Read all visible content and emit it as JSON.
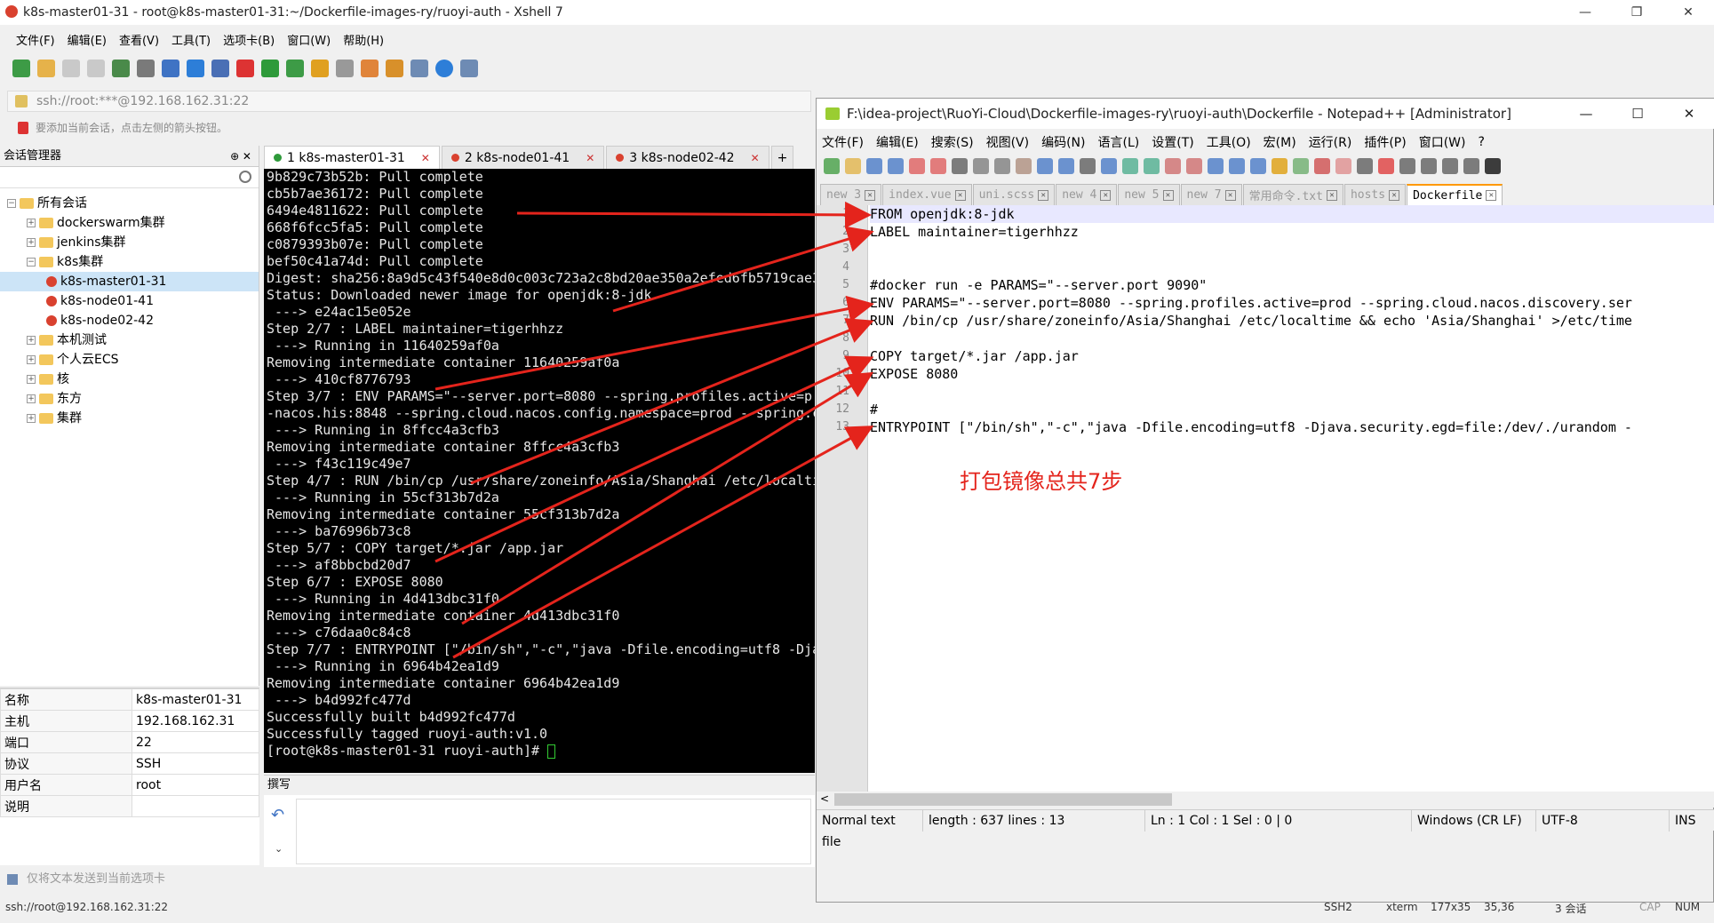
{
  "xshell": {
    "title": "k8s-master01-31 - root@k8s-master01-31:~/Dockerfile-images-ry/ruoyi-auth - Xshell 7",
    "menu": [
      "文件(F)",
      "编辑(E)",
      "查看(V)",
      "工具(T)",
      "选项卡(B)",
      "窗口(W)",
      "帮助(H)"
    ],
    "address": "ssh://root:***@192.168.162.31:22",
    "hint": "要添加当前会话，点击左侧的箭头按钮。",
    "session_manager": {
      "title": "会话管理器",
      "pins": "⊕ ✕",
      "tree": [
        {
          "label": "所有会话",
          "level": 0,
          "kind": "folder"
        },
        {
          "label": "dockerswarm集群",
          "level": 1,
          "kind": "folder"
        },
        {
          "label": "jenkins集群",
          "level": 1,
          "kind": "folder"
        },
        {
          "label": "k8s集群",
          "level": 1,
          "kind": "folder"
        },
        {
          "label": "k8s-master01-31",
          "level": 2,
          "kind": "session"
        },
        {
          "label": "k8s-node01-41",
          "level": 2,
          "kind": "session"
        },
        {
          "label": "k8s-node02-42",
          "level": 2,
          "kind": "session"
        },
        {
          "label": "本机测试",
          "level": 1,
          "kind": "folder"
        },
        {
          "label": "个人云ECS",
          "level": 1,
          "kind": "folder"
        },
        {
          "label": "核",
          "level": 1,
          "kind": "folder"
        },
        {
          "label": "东方",
          "level": 1,
          "kind": "folder"
        },
        {
          "label": "集群",
          "level": 1,
          "kind": "folder"
        }
      ]
    },
    "properties": [
      {
        "key": "名称",
        "value": "k8s-master01-31"
      },
      {
        "key": "主机",
        "value": "192.168.162.31"
      },
      {
        "key": "端口",
        "value": "22"
      },
      {
        "key": "协议",
        "value": "SSH"
      },
      {
        "key": "用户名",
        "value": "root"
      },
      {
        "key": "说明",
        "value": ""
      }
    ],
    "tabs": [
      {
        "label": "1 k8s-master01-31",
        "color": "#2e9a3a",
        "close": "✕"
      },
      {
        "label": "2 k8s-node01-41",
        "color": "#d9412f",
        "close": "✕"
      },
      {
        "label": "3 k8s-node02-42",
        "color": "#d9412f",
        "close": "✕"
      }
    ],
    "add_tab": "+",
    "terminal_lines": [
      "9b829c73b52b: Pull complete",
      "cb5b7ae36172: Pull complete",
      "6494e4811622: Pull complete",
      "668f6fcc5fa5: Pull complete",
      "c0879393b07e: Pull complete",
      "bef50c41a74d: Pull complete",
      "Digest: sha256:8a9d5c43f540e8d0c003c723a2c8bd20ae350a2efed6fb5719cae3",
      "Status: Downloaded newer image for openjdk:8-jdk",
      " ---> e24ac15e052e",
      "Step 2/7 : LABEL maintainer=tigerhhzz",
      " ---> Running in 11640259af0a",
      "Removing intermediate container 11640259af0a",
      " ---> 410cf8776793",
      "Step 3/7 : ENV PARAMS=\"--server.port=8080 --spring.profiles.active=p",
      "-nacos.his:8848 --spring.cloud.nacos.config.namespace=prod --spring.c",
      " ---> Running in 8ffcc4a3cfb3",
      "Removing intermediate container 8ffcc4a3cfb3",
      " ---> f43c119c49e7",
      "Step 4/7 : RUN /bin/cp /usr/share/zoneinfo/Asia/Shanghai /etc/localti",
      " ---> Running in 55cf313b7d2a",
      "Removing intermediate container 55cf313b7d2a",
      " ---> ba76996b73c8",
      "Step 5/7 : COPY target/*.jar /app.jar",
      " ---> af8bbcbd20d7",
      "Step 6/7 : EXPOSE 8080",
      " ---> Running in 4d413dbc31f0",
      "Removing intermediate container 4d413dbc31f0",
      " ---> c76daa0c84c8",
      "Step 7/7 : ENTRYPOINT [\"/bin/sh\",\"-c\",\"java -Dfile.encoding=utf8 -Dja",
      " ---> Running in 6964b42ea1d9",
      "Removing intermediate container 6964b42ea1d9",
      " ---> b4d992fc477d",
      "Successfully built b4d992fc477d",
      "Successfully tagged ruoyi-auth:v1.0",
      "[root@k8s-master01-31 ruoyi-auth]# "
    ],
    "compose_title": "撰写",
    "send_hint": "仅将文本发送到当前选项卡",
    "status_left": "ssh://root@192.168.162.31:22",
    "status_right": [
      "SSH2",
      "xterm",
      "177x35",
      "35,36",
      "3 会话",
      "CAP",
      "NUM"
    ]
  },
  "notepad": {
    "title": "F:\\idea-project\\RuoYi-Cloud\\Dockerfile-images-ry\\ruoyi-auth\\Dockerfile - Notepad++ [Administrator]",
    "menu": [
      "文件(F)",
      "编辑(E)",
      "搜索(S)",
      "视图(V)",
      "编码(N)",
      "语言(L)",
      "设置(T)",
      "工具(O)",
      "宏(M)",
      "运行(R)",
      "插件(P)",
      "窗口(W)",
      "?"
    ],
    "tabs": [
      "new 3",
      "index.vue",
      "uni.scss",
      "new 4",
      "new 5",
      "new 7",
      "常用命令.txt",
      "hosts",
      "Dockerfile"
    ],
    "active_tab": "Dockerfile",
    "code_lines": [
      "FROM openjdk:8-jdk",
      "LABEL maintainer=tigerhhzz",
      "",
      "",
      "#docker run -e PARAMS=\"--server.port 9090\"",
      "ENV PARAMS=\"--server.port=8080 --spring.profiles.active=prod --spring.cloud.nacos.discovery.ser",
      "RUN /bin/cp /usr/share/zoneinfo/Asia/Shanghai /etc/localtime && echo 'Asia/Shanghai' >/etc/time",
      "",
      "COPY target/*.jar /app.jar",
      "EXPOSE 8080",
      "",
      "#",
      "ENTRYPOINT [\"/bin/sh\",\"-c\",\"java -Dfile.encoding=utf8 -Djava.security.egd=file:/dev/./urandom -"
    ],
    "line_numbers": [
      "1",
      "2",
      "3",
      "4",
      "5",
      "6",
      "7",
      "8",
      "9",
      "10",
      "11",
      "12",
      "13"
    ],
    "annotation": "打包镜像总共7步",
    "annotation_color": "#e4241c",
    "status": [
      "Normal text file",
      "length : 637    lines : 13",
      "Ln : 1    Col : 1    Sel : 0 | 0",
      "Windows (CR LF)",
      "UTF-8",
      "INS"
    ]
  }
}
